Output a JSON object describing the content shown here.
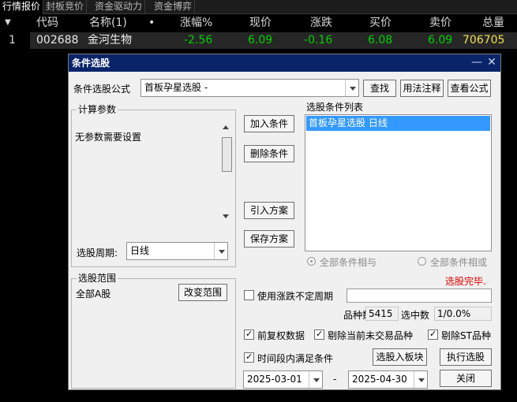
{
  "tabs": [
    "行情报价",
    "封板竞价",
    "资金驱动力",
    "资金博弈"
  ],
  "columns": {
    "code": "代码",
    "name": "名称(1)",
    "dot": "•",
    "pct": "涨幅%",
    "price": "现价",
    "change": "涨跌",
    "bid": "买价",
    "ask": "卖价",
    "volume": "总量"
  },
  "row": {
    "index": "1",
    "code": "002688",
    "name": "金河生物",
    "pct": "-2.56",
    "price": "6.09",
    "change": "-0.16",
    "bid": "6.08",
    "ask": "6.09",
    "volume": "706705"
  },
  "colors": {
    "down": "#00d200",
    "volume": "#f0e050",
    "dialog_title": "#0a246a",
    "status": "#e00000"
  },
  "dialog": {
    "title": "条件选股",
    "formula_label": "条件选股公式",
    "formula_value": "首板孕星选股  -",
    "find_button": "查找",
    "usage_button": "用法注释",
    "view_formula_button": "查看公式",
    "params_group": "计算参数",
    "params_text": "无参数需要设置",
    "period_label": "选股周期:",
    "period_value": "日线",
    "range_group": "选股范围",
    "range_value": "全部A股",
    "change_range_button": "改变范围",
    "add_condition_button": "加入条件",
    "delete_condition_button": "删除条件",
    "import_scheme_button": "引入方案",
    "save_scheme_button": "保存方案",
    "condition_list_label": "选股条件列表",
    "condition_items": [
      "首板孕星选股  日线"
    ],
    "radio_and": "全部条件相与",
    "radio_or": "全部条件相或",
    "status_text": "选股完毕.",
    "uncertain_period_label": "使用涨跌不定周期",
    "count_label": "品种数",
    "count_value": "5415",
    "selected_label": "选中数",
    "selected_value": "1/0.0%",
    "pre_adjust_label": "前复权数据",
    "exclude_untraded_label": "剔除当前未交易品种",
    "exclude_st_label": "剔除ST品种",
    "period_satisfy_label": "时间段内满足条件",
    "to_block_button": "选股入板块",
    "execute_button": "执行选股",
    "date_from": "2025-03-01",
    "date_sep": "-",
    "date_to": "2025-04-30",
    "close_button": "关闭"
  }
}
